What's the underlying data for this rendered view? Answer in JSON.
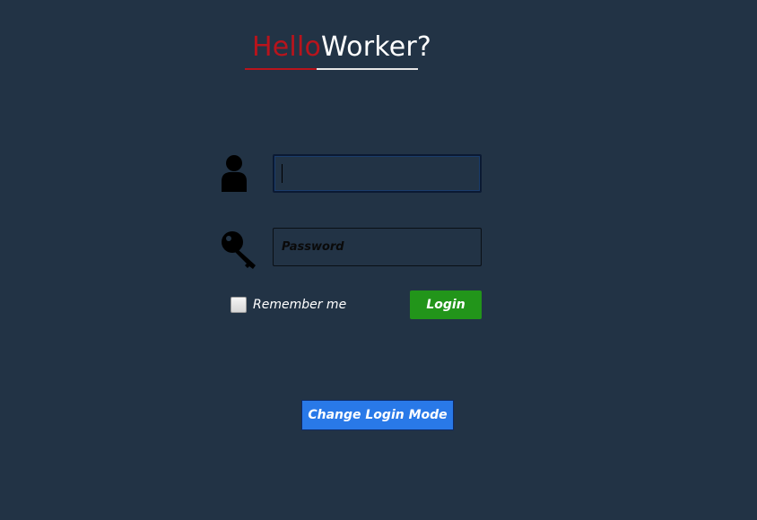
{
  "brand": {
    "hello": "Hello",
    "worker": "Worker?"
  },
  "colors": {
    "background": "#223345",
    "accent_red": "#b8141c",
    "login_green": "#22951a",
    "mode_blue": "#2979e8"
  },
  "icons": {
    "user": "user-icon",
    "key": "key-icon"
  },
  "form": {
    "username": {
      "value": "",
      "placeholder": ""
    },
    "password": {
      "value": "",
      "placeholder": "Password"
    },
    "remember_label": "Remember me",
    "remember_checked": false,
    "login_label": "Login"
  },
  "change_mode_label": "Change Login Mode"
}
